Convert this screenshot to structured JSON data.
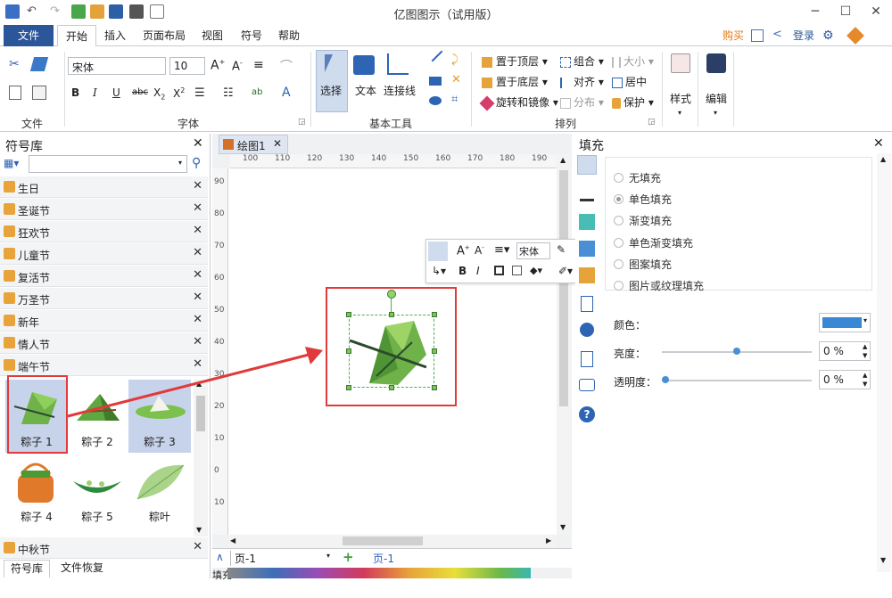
{
  "app": {
    "title": "亿图图示（试用版）",
    "accent": "#2b579a"
  },
  "ribbon_tabs": [
    "文件",
    "开始",
    "插入",
    "页面布局",
    "视图",
    "符号",
    "帮助"
  ],
  "top_right": {
    "buy": "购买",
    "login": "登录"
  },
  "ribbon": {
    "font_name": "宋体",
    "font_size": "10",
    "group_file": "文件",
    "group_font": "字体",
    "group_tools": "基本工具",
    "group_arrange": "排列",
    "select": "选择",
    "text": "文本",
    "connector": "连接线",
    "to_top": "置于顶层",
    "to_bottom": "置于底层",
    "rotate": "旋转和镜像",
    "group": "组合",
    "align": "对齐",
    "distribute": "分布",
    "size": "大小",
    "center": "居中",
    "protect": "保护",
    "style": "样式",
    "edit": "编辑"
  },
  "library": {
    "title": "符号库",
    "search_placeholder": "",
    "categories": [
      "生日",
      "圣诞节",
      "狂欢节",
      "儿童节",
      "复活节",
      "万圣节",
      "新年",
      "情人节",
      "端午节"
    ],
    "shapes": [
      "粽子 1",
      "粽子 2",
      "粽子 3",
      "粽子 4",
      "粽子 5",
      "粽叶"
    ],
    "bottom_category": "中秋节",
    "tabs": [
      "符号库",
      "文件恢复"
    ]
  },
  "document": {
    "tab": "绘图1",
    "ruler_h": [
      "100",
      "110",
      "120",
      "130",
      "140",
      "150",
      "160",
      "170",
      "180",
      "190"
    ],
    "ruler_v": [
      "90",
      "80",
      "70",
      "60",
      "50",
      "40",
      "30",
      "20",
      "10",
      "0",
      "10"
    ],
    "page_select": "页-1",
    "page_tab": "页-1",
    "fill_label": "填充",
    "mini_font": "宋体"
  },
  "fill_panel": {
    "title": "填充",
    "options": [
      "无填充",
      "单色填充",
      "渐变填充",
      "单色渐变填充",
      "图案填充",
      "图片或纹理填充"
    ],
    "selected": "单色填充",
    "color_label": "颜色：",
    "color_value": "#3a87d6",
    "brightness_label": "亮度：",
    "brightness_value": "0 %",
    "transparency_label": "透明度：",
    "transparency_value": "0 %"
  }
}
